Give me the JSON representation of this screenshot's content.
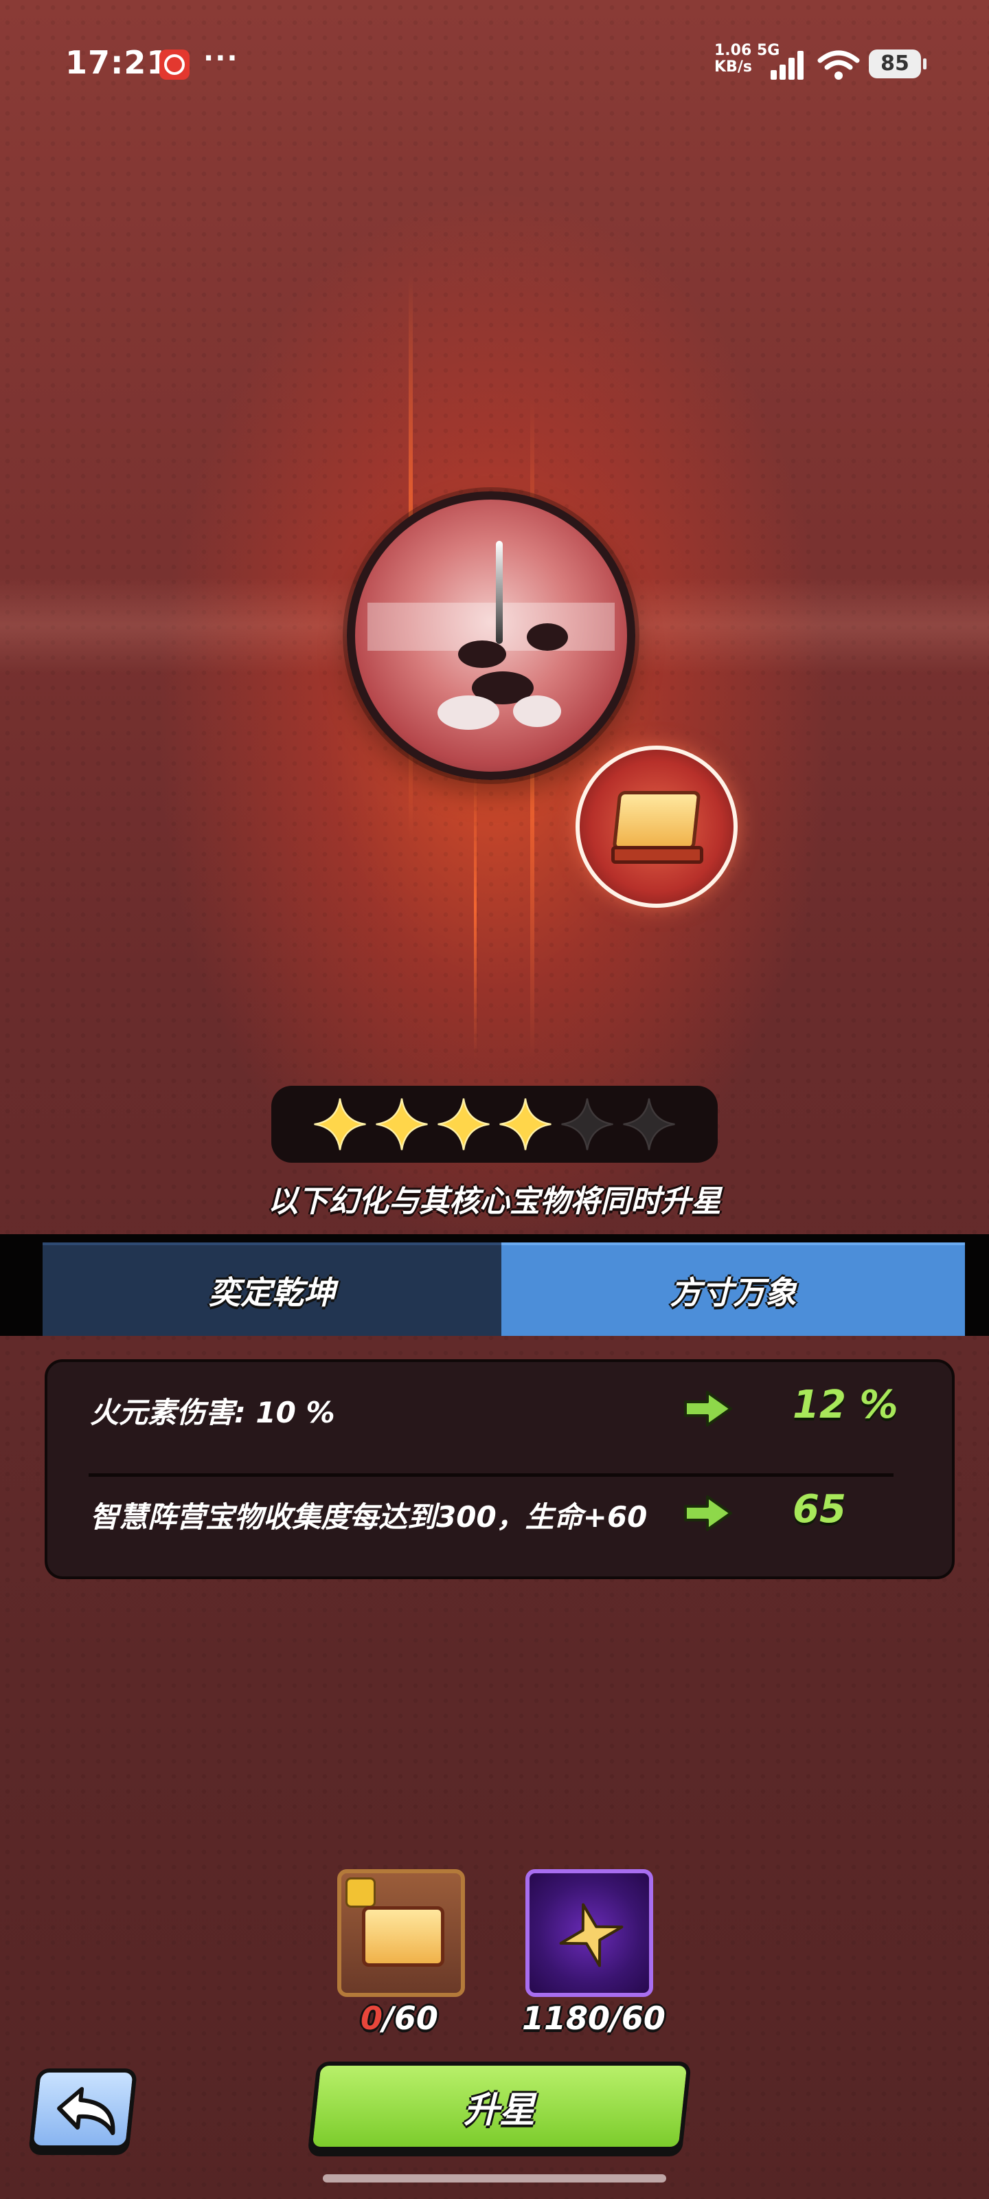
{
  "status_bar": {
    "time": "17:21",
    "more": "···",
    "net_speed": "1.06",
    "net_unit": "KB/s",
    "net_type": "5G",
    "battery": "85"
  },
  "star_rating": {
    "filled": 4,
    "total": 6
  },
  "notice": "以下幻化与其核心宝物将同时升星",
  "tabs": [
    {
      "label": "奕定乾坤",
      "active": false
    },
    {
      "label": "方寸万象",
      "active": true
    }
  ],
  "stats": [
    {
      "label": "火元素伤害: 10 %",
      "new_value": "12 %"
    },
    {
      "label": "智慧阵营宝物收集度每达到300，生命+60",
      "new_value": "65"
    }
  ],
  "costs": [
    {
      "name": "treasure-fragment",
      "have": "0",
      "need": "/60"
    },
    {
      "name": "star-material",
      "have": "1180",
      "need": "/60"
    }
  ],
  "upgrade_button": "升星",
  "colors": {
    "accent_green": "#a8e85a",
    "tab_active": "#4c8ed9",
    "tab_inactive": "#223551",
    "insufficient_red": "#e8463b"
  }
}
